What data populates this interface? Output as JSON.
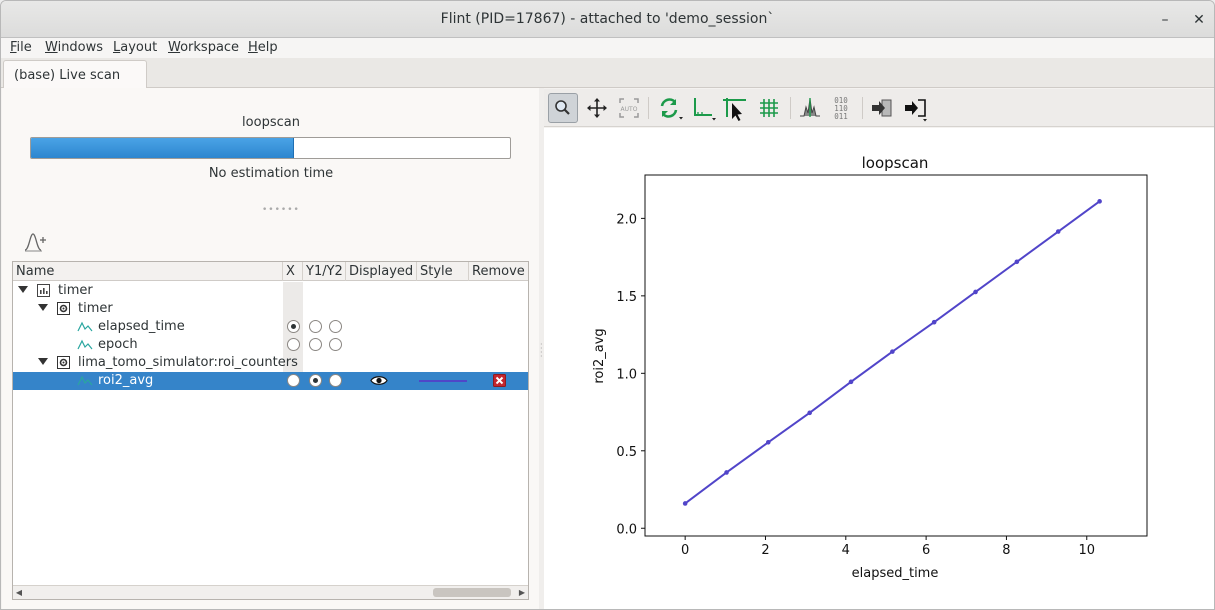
{
  "window": {
    "title": "Flint (PID=17867) - attached to 'demo_session`"
  },
  "window_controls": {
    "minimize": "–",
    "close": "✕"
  },
  "menubar": [
    {
      "label": "File",
      "key": "F",
      "rest": "ile"
    },
    {
      "label": "Windows",
      "key": "W",
      "rest": "indows"
    },
    {
      "label": "Layout",
      "key": "L",
      "rest": "ayout"
    },
    {
      "label": "Workspace",
      "key": "W",
      "rest": "orkspace"
    },
    {
      "label": "Help",
      "key": "H",
      "rest": "elp"
    }
  ],
  "tab": {
    "label": "(base) Live scan"
  },
  "scan": {
    "name": "loopscan",
    "progress_fraction": 0.55,
    "estimation": "No estimation time"
  },
  "tree": {
    "columns": [
      "Name",
      "X",
      "Y1/Y2",
      "Displayed",
      "Style",
      "Remove"
    ],
    "rows": [
      {
        "label": "timer",
        "icon": "scan-icon"
      },
      {
        "label": "timer",
        "icon": "device-icon"
      },
      {
        "label": "elapsed_time",
        "icon": "curve-icon",
        "x": true,
        "y1": false,
        "y2": false
      },
      {
        "label": "epoch",
        "icon": "curve-icon",
        "x": false,
        "y1": false,
        "y2": false
      },
      {
        "label": "lima_tomo_simulator:roi_counters",
        "icon": "device-icon"
      },
      {
        "label": "roi2_avg",
        "icon": "curve-icon",
        "x": false,
        "y1": true,
        "y2": false,
        "displayed": "eye-icon",
        "style_color": "#4f46c8",
        "remove": "remove-icon"
      }
    ]
  },
  "toolbar": {
    "buttons": [
      "zoom-mode-icon",
      "pan-mode-icon",
      "auto-scale-icon",
      "refresh-icon",
      "axes-options-icon",
      "crosshair-cursor-icon",
      "grid-icon",
      "histogram-icon",
      "binary-data-icon",
      "import-icon",
      "export-icon"
    ]
  },
  "chart_data": {
    "type": "line",
    "title": "loopscan",
    "xlabel": "elapsed_time",
    "ylabel": "roi2_avg",
    "xlim": [
      -1,
      11.5
    ],
    "ylim": [
      -0.05,
      2.28
    ],
    "xticks": [
      0,
      2,
      4,
      6,
      8,
      10
    ],
    "yticks": [
      0.0,
      0.5,
      1.0,
      1.5,
      2.0
    ],
    "grid": false,
    "series": [
      {
        "color": "#5145c9",
        "x": [
          0,
          1.03,
          2.07,
          3.1,
          4.13,
          5.16,
          6.2,
          7.23,
          8.26,
          9.29,
          10.32
        ],
        "y": [
          0.16,
          0.36,
          0.555,
          0.745,
          0.945,
          1.14,
          1.33,
          1.525,
          1.72,
          1.915,
          2.11
        ]
      }
    ]
  }
}
